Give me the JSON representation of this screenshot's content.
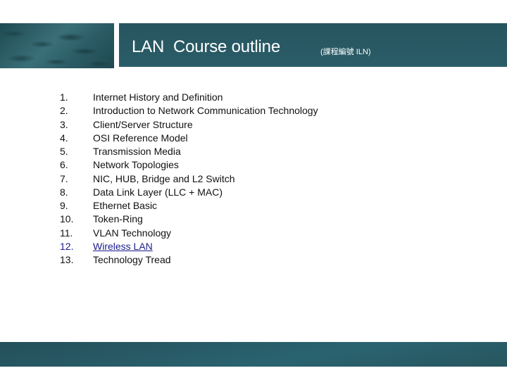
{
  "header": {
    "title": "LAN  Course outline",
    "subtitle": "(課程編號 ILN)"
  },
  "outline": {
    "items": [
      {
        "number": "1.",
        "label": "Internet History and Definition"
      },
      {
        "number": "2.",
        "label": "Introduction to Network Communication Technology"
      },
      {
        "number": "3.",
        "label": "Client/Server Structure"
      },
      {
        "number": "4.",
        "label": "OSI Reference Model"
      },
      {
        "number": "5.",
        "label": "Transmission Media"
      },
      {
        "number": "6.",
        "label": "Network Topologies"
      },
      {
        "number": "7.",
        "label": "NIC, HUB, Bridge and L2 Switch"
      },
      {
        "number": "8.",
        "label": "Data Link Layer (LLC + MAC)"
      },
      {
        "number": "9.",
        "label": "Ethernet Basic"
      },
      {
        "number": "10.",
        "label": "Token-Ring"
      },
      {
        "number": "11.",
        "label": "VLAN Technology"
      },
      {
        "number": "12.",
        "label": "Wireless LAN",
        "link": true
      },
      {
        "number": "13.",
        "label": "Technology Tread"
      }
    ]
  },
  "colors": {
    "band": "#27555f",
    "link": "#1a1a8c",
    "text": "#111111"
  }
}
